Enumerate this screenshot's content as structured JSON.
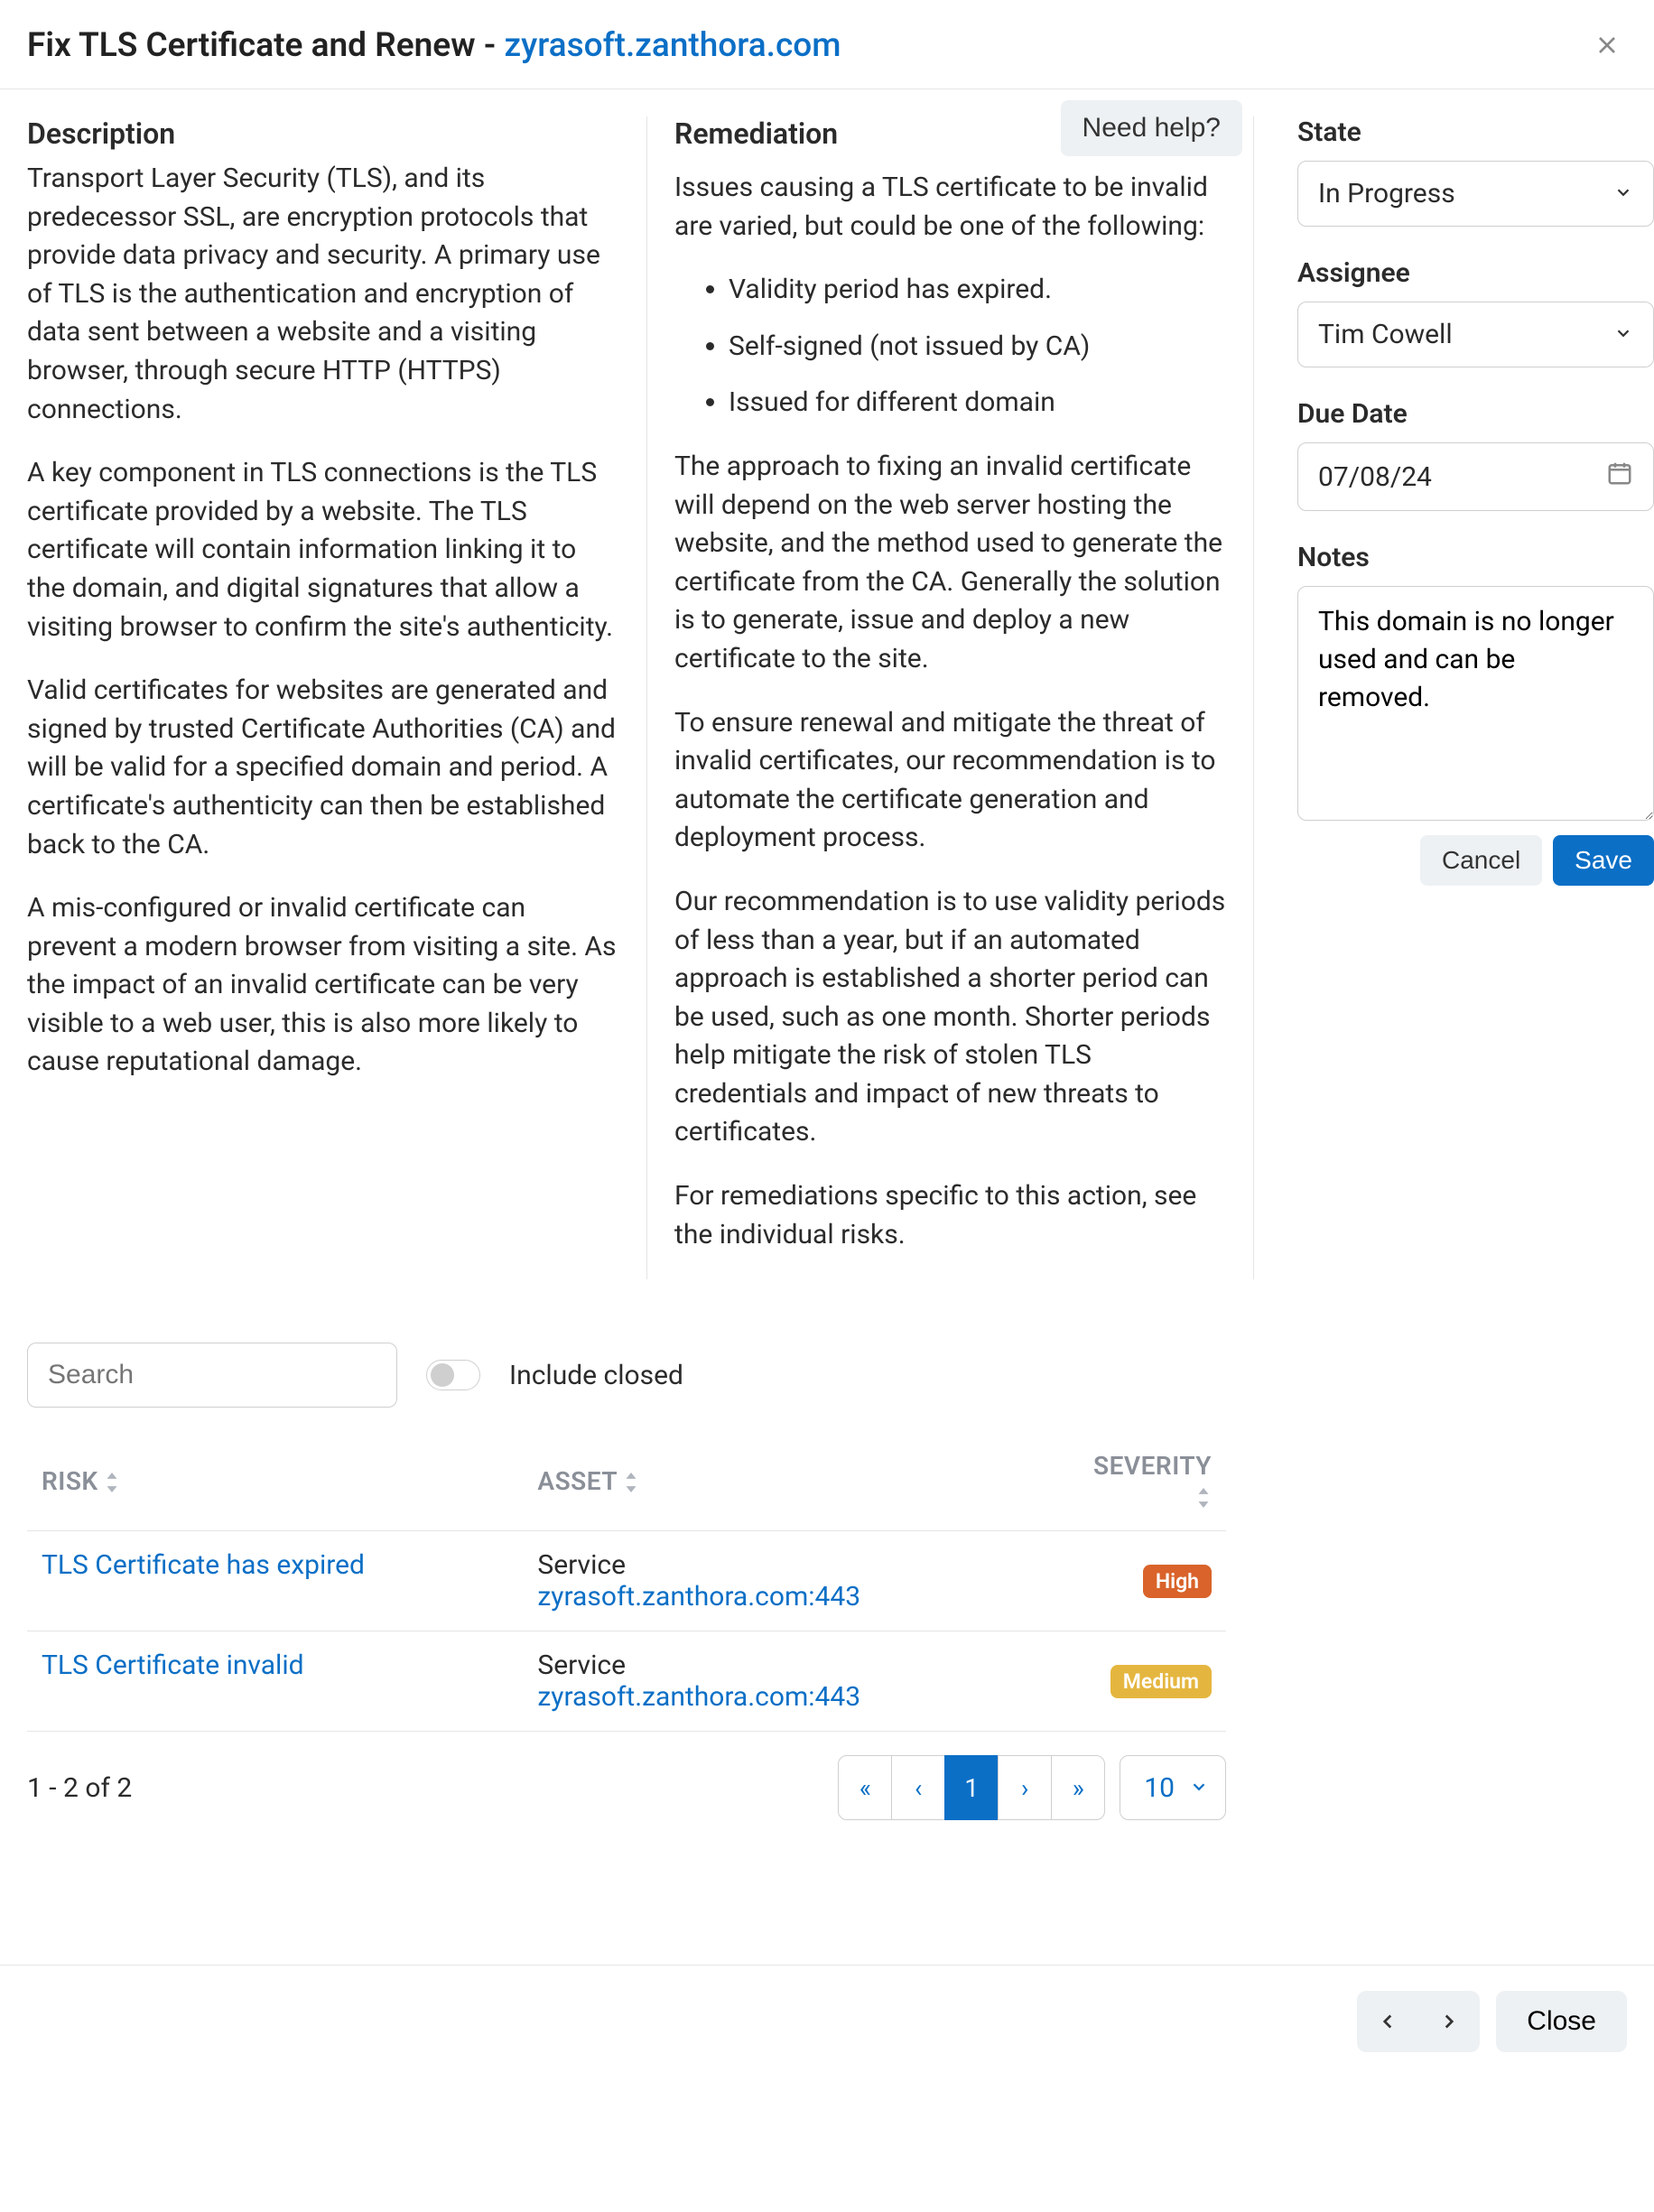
{
  "header": {
    "title_prefix": "Fix TLS Certificate and Renew - ",
    "domain": "zyrasoft.zanthora.com"
  },
  "description": {
    "heading": "Description",
    "p1": "Transport Layer Security (TLS), and its predecessor SSL, are encryption protocols that provide data privacy and security. A primary use of TLS is the authentication and encryption of data sent between a website and a visiting browser, through secure HTTP (HTTPS) connections.",
    "p2": "A key component in TLS connections is the TLS certificate provided by a website. The TLS certificate will contain information linking it to the domain, and digital signatures that allow a visiting browser to confirm the site's authenticity.",
    "p3": "Valid certificates for websites are generated and signed by trusted Certificate Authorities (CA) and will be valid for a specified domain and period. A certificate's authenticity can then be established back to the CA.",
    "p4": "A mis-configured or invalid certificate can prevent a modern browser from visiting a site. As the impact of an invalid certificate can be very visible to a web user, this is also more likely to cause reputational damage."
  },
  "remediation": {
    "heading": "Remediation",
    "need_help": "Need help?",
    "p1": "Issues causing a TLS certificate to be invalid are varied, but could be one of the following:",
    "bullets": [
      "Validity period has expired.",
      "Self-signed (not issued by CA)",
      "Issued for different domain"
    ],
    "p2": "The approach to fixing an invalid certificate will depend on the web server hosting the website, and the method used to generate the certificate from the CA. Generally the solution is to generate, issue and deploy a new certificate to the site.",
    "p3": "To ensure renewal and mitigate the threat of invalid certificates, our recommendation is to automate the certificate generation and deployment process.",
    "p4": "Our recommendation is to use validity periods of less than a year, but if an automated approach is established a shorter period can be used, such as one month. Shorter periods help mitigate the risk of stolen TLS credentials and impact of new threats to certificates.",
    "p5": "For remediations specific to this action, see the individual risks."
  },
  "sidebar": {
    "state_label": "State",
    "state_value": "In Progress",
    "assignee_label": "Assignee",
    "assignee_value": "Tim Cowell",
    "due_label": "Due Date",
    "due_value": "07/08/24",
    "notes_label": "Notes",
    "notes_value": "This domain is no longer used and can be removed.",
    "cancel": "Cancel",
    "save": "Save"
  },
  "table": {
    "search_placeholder": "Search",
    "include_closed": "Include closed",
    "columns": {
      "risk": "RISK",
      "asset": "ASSET",
      "severity": "SEVERITY"
    },
    "rows": [
      {
        "risk": "TLS Certificate has expired",
        "asset_type": "Service",
        "asset_name": "zyrasoft.zanthora.com:443",
        "severity": "High",
        "severity_class": "badge-high"
      },
      {
        "risk": "TLS Certificate invalid",
        "asset_type": "Service",
        "asset_name": "zyrasoft.zanthora.com:443",
        "severity": "Medium",
        "severity_class": "badge-medium"
      }
    ],
    "row_count": "1 - 2 of 2",
    "page_current": "1",
    "page_size": "10"
  },
  "footer": {
    "close": "Close"
  }
}
